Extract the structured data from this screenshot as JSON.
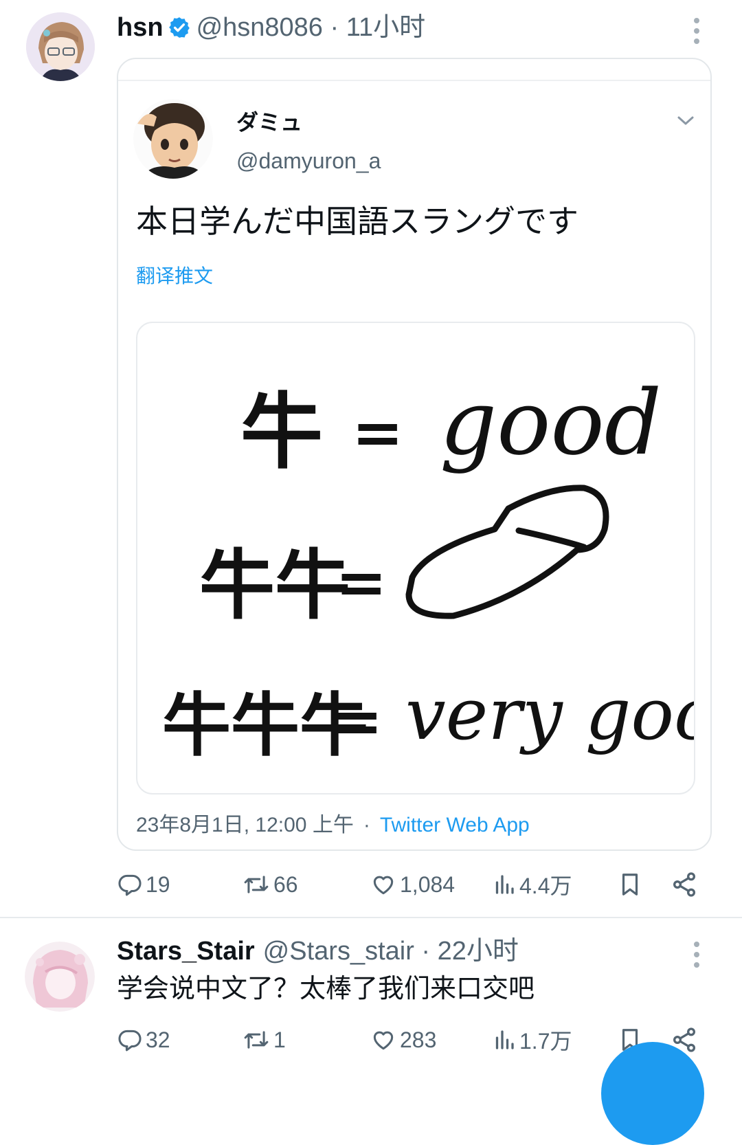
{
  "tweets": [
    {
      "author_name": "hsn",
      "handle": "@hsn8086",
      "time": "11小时",
      "quoted": {
        "author_name": "ダミュ",
        "handle": "@damyuron_a",
        "text": "本日学んだ中国語スラングです",
        "translate_label": "翻译推文",
        "image_lines": [
          {
            "left": "牛",
            "right": "good"
          },
          {
            "left": "牛牛",
            "right": ""
          },
          {
            "left": "牛牛牛",
            "right": "very good"
          }
        ],
        "timestamp": "23年8月1日, 12:00 上午",
        "separator": "·",
        "source": "Twitter Web App"
      },
      "stats": {
        "replies": "19",
        "retweets": "66",
        "likes": "1,084",
        "views": "4.4万"
      }
    },
    {
      "author_name": "Stars_Stair",
      "handle": "@Stars_stair",
      "time": "22小时",
      "text": "学会说中文了？太棒了我们来口交吧",
      "stats": {
        "replies": "32",
        "retweets": "1",
        "likes": "283",
        "views": "1.7万"
      }
    }
  ],
  "colors": {
    "accent": "#1d9bf0",
    "link": "#1d9bf0",
    "secondary_text": "#536471",
    "border": "#e3e7ea"
  },
  "icons": [
    "verified-badge-icon",
    "more-icon",
    "chevron-down-icon",
    "reply-icon",
    "retweet-icon",
    "like-icon",
    "views-icon",
    "bookmark-icon",
    "share-icon"
  ]
}
